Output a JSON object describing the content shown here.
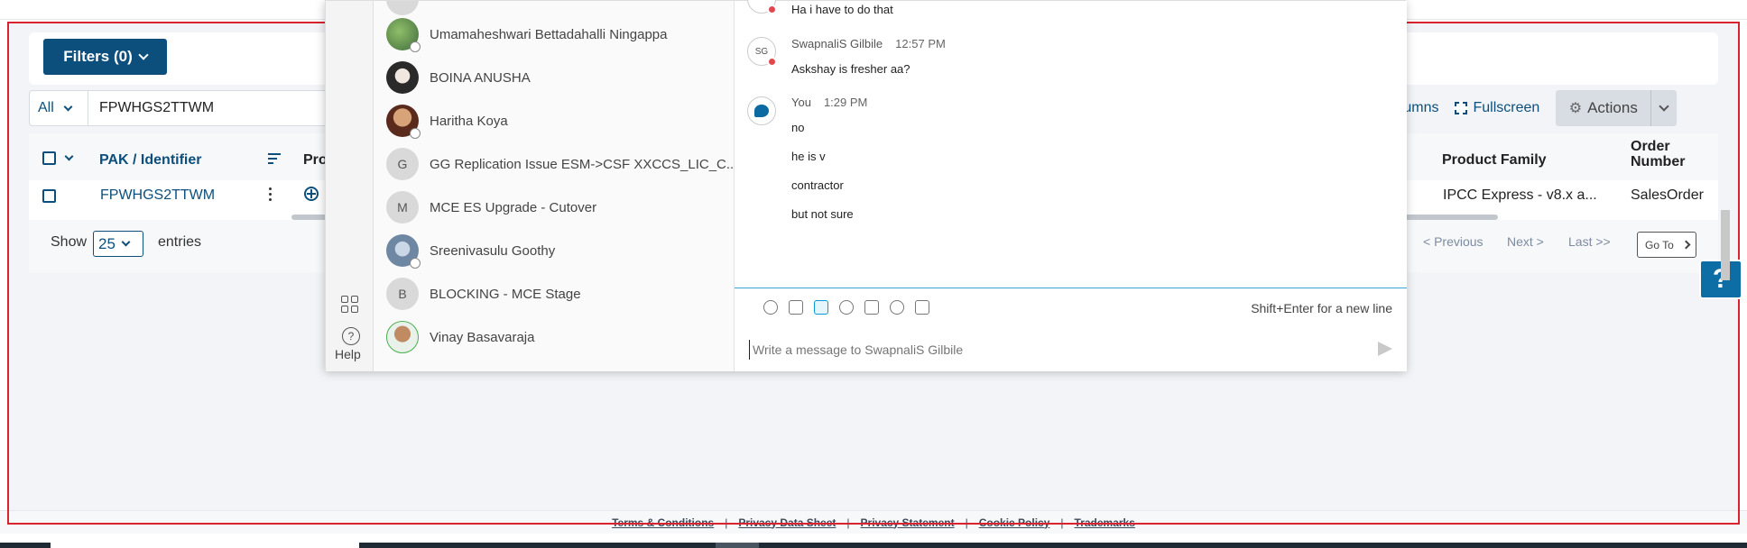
{
  "filters": {
    "label": "Filters (0)"
  },
  "search": {
    "scope": "All",
    "value": "FPWHGS2TTWM"
  },
  "toolbar": {
    "columns_label": "e Columns",
    "fullscreen_label": "Fullscreen",
    "actions_label": "Actions"
  },
  "table": {
    "headers": {
      "pak": "PAK / Identifier",
      "prod": "Pro",
      "product_family": "Product Family",
      "order_number": "Order Number"
    },
    "row": {
      "pak": "FPWHGS2TTWM",
      "product_family": "IPCC Express - v8.x a...",
      "order_number": "SalesOrder"
    }
  },
  "pagination": {
    "show": "Show",
    "page_size": "25",
    "entries": "entries",
    "previous": "< Previous",
    "next": "Next >",
    "last": "Last >>",
    "goto": "Go To"
  },
  "help_fab": "?",
  "footer": {
    "links": [
      "Terms & Conditions",
      "Privacy Data Sheet",
      "Privacy Statement",
      "Cookie Policy",
      "Trademarks"
    ],
    "separator": "|"
  },
  "chat": {
    "rail": {
      "help_label": "Help"
    },
    "contacts": [
      {
        "name": "Umamaheshwari Bettadahalli Ningappa",
        "initials": ""
      },
      {
        "name": "BOINA ANUSHA",
        "initials": ""
      },
      {
        "name": "Haritha Koya",
        "initials": ""
      },
      {
        "name": "GG Replication Issue ESM->CSF XXCCS_LIC_C...",
        "initials": "G"
      },
      {
        "name": "MCE ES Upgrade - Cutover",
        "initials": "M"
      },
      {
        "name": "Sreenivasulu Goothy",
        "initials": ""
      },
      {
        "name": "BLOCKING - MCE Stage",
        "initials": "B"
      },
      {
        "name": "Vinay Basavaraja",
        "initials": ""
      }
    ],
    "messages": {
      "prev_text": "Ha i have to do that",
      "m1": {
        "sender": "SwapnaliS Gilbile",
        "time": "12:57 PM",
        "avatar": "SG",
        "lines": [
          "Askshay is fresher aa?"
        ]
      },
      "m2": {
        "sender": "You",
        "time": "1:29 PM",
        "lines": [
          "no",
          "he is v",
          "contractor",
          "but not sure"
        ]
      }
    },
    "composer": {
      "hint": "Shift+Enter for a new line",
      "placeholder": "Write a message to SwapnaliS Gilbile"
    }
  }
}
